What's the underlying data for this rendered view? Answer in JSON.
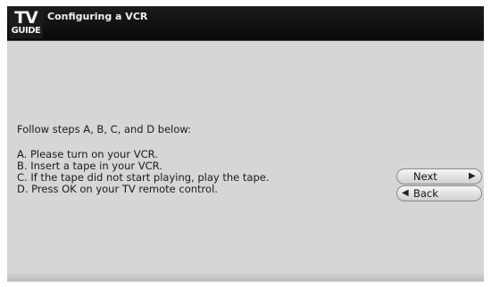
{
  "header": {
    "logo_top": "TV",
    "logo_bottom": "GUIDE",
    "title": "Configuring a VCR"
  },
  "content": {
    "intro": "Follow steps A, B, C, and D below:",
    "steps": [
      "A. Please turn on your VCR.",
      "B. Insert a tape in your VCR.",
      "C. If the tape did not start playing, play the tape.",
      "D. Press OK on your TV remote control."
    ]
  },
  "buttons": {
    "next_label": "Next",
    "back_label": "Back"
  },
  "icons": {
    "next": "chevron-right-icon",
    "back": "chevron-left-icon"
  }
}
